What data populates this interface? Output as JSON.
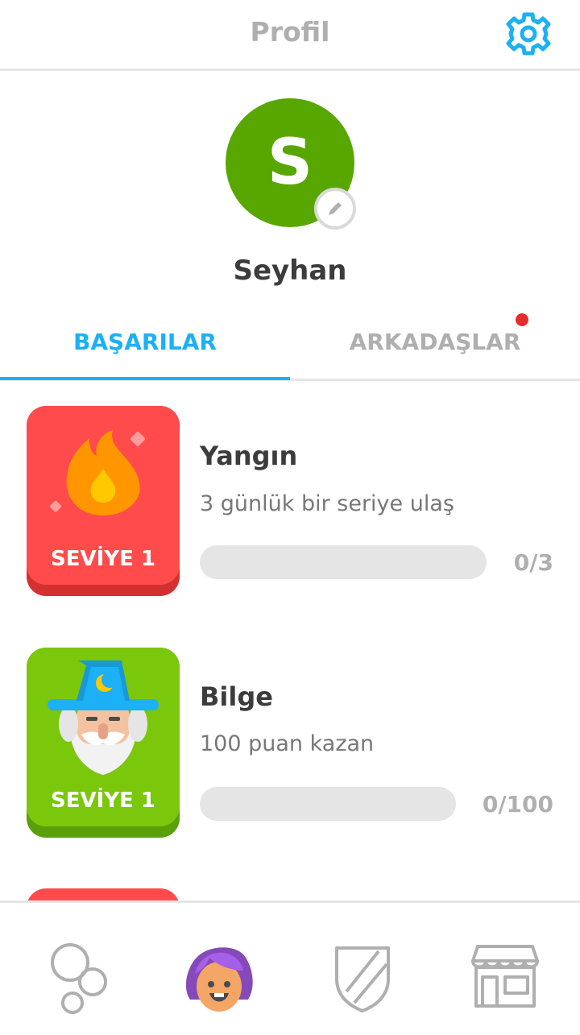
{
  "header": {
    "title": "Profil",
    "settings_icon": "gear-icon"
  },
  "profile": {
    "avatar_letter": "S",
    "username": "Seyhan",
    "edit_icon": "pencil-icon"
  },
  "tabs": [
    {
      "label": "BAŞARILAR",
      "active": true
    },
    {
      "label": "ARKADAŞLAR",
      "active": false,
      "has_notification": true
    }
  ],
  "achievements": [
    {
      "title": "Yangın",
      "description": "3 günlük bir seriye ulaş",
      "level": "SEVİYE 1",
      "progress": "0/3",
      "progress_fraction": 0,
      "badge_color": "#ff4b4b",
      "icon": "flame-icon"
    },
    {
      "title": "Bilge",
      "description": "100 puan kazan",
      "level": "SEVİYE 1",
      "progress": "0/100",
      "progress_fraction": 0,
      "badge_color": "#7ac70c",
      "icon": "wizard-icon"
    }
  ],
  "bottom_nav": [
    {
      "name": "learn",
      "icon": "bubbles-icon"
    },
    {
      "name": "profile",
      "icon": "profile-face-icon",
      "active": true
    },
    {
      "name": "leagues",
      "icon": "shield-icon"
    },
    {
      "name": "shop",
      "icon": "shop-icon"
    }
  ],
  "colors": {
    "accent": "#1cb0f6",
    "avatar": "#58a700",
    "inactive": "#afafaf",
    "notification": "#ea2b2b"
  }
}
